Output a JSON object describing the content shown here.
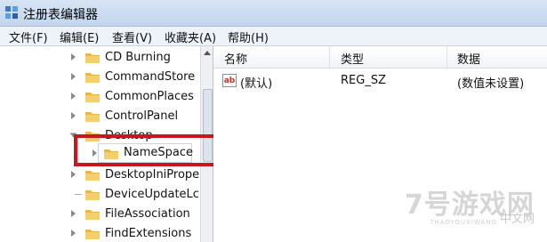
{
  "window": {
    "title": "注册表编辑器",
    "icon": "registry-editor-icon"
  },
  "menu": [
    {
      "label": "文件(F)"
    },
    {
      "label": "编辑(E)"
    },
    {
      "label": "查看(V)"
    },
    {
      "label": "收藏夹(A)"
    },
    {
      "label": "帮助(H)"
    }
  ],
  "tree": {
    "items": [
      {
        "label": "CD Burning"
      },
      {
        "label": "CommandStore"
      },
      {
        "label": "CommonPlaces"
      },
      {
        "label": "ControlPanel"
      },
      {
        "label": "Desktop"
      },
      {
        "label": "NameSpace"
      },
      {
        "label": "DesktopIniPrope"
      },
      {
        "label": "DeviceUpdateLc"
      },
      {
        "label": "FileAssociation"
      },
      {
        "label": "FindExtensions"
      }
    ],
    "selected": "NameSpace"
  },
  "list": {
    "headers": [
      "名称",
      "类型",
      "数据"
    ],
    "rows": [
      {
        "name": "(默认)",
        "type": "REG_SZ",
        "data": "(数值未设置)",
        "icon": "ab"
      }
    ]
  },
  "watermark": {
    "main": "7号游戏网",
    "sub": "7HAOYOUXIWANG",
    "cn": "中文网"
  },
  "colors": {
    "highlight": "#c8161e",
    "titlebar": "#c8d9ef",
    "folder": "#e8b64a"
  }
}
